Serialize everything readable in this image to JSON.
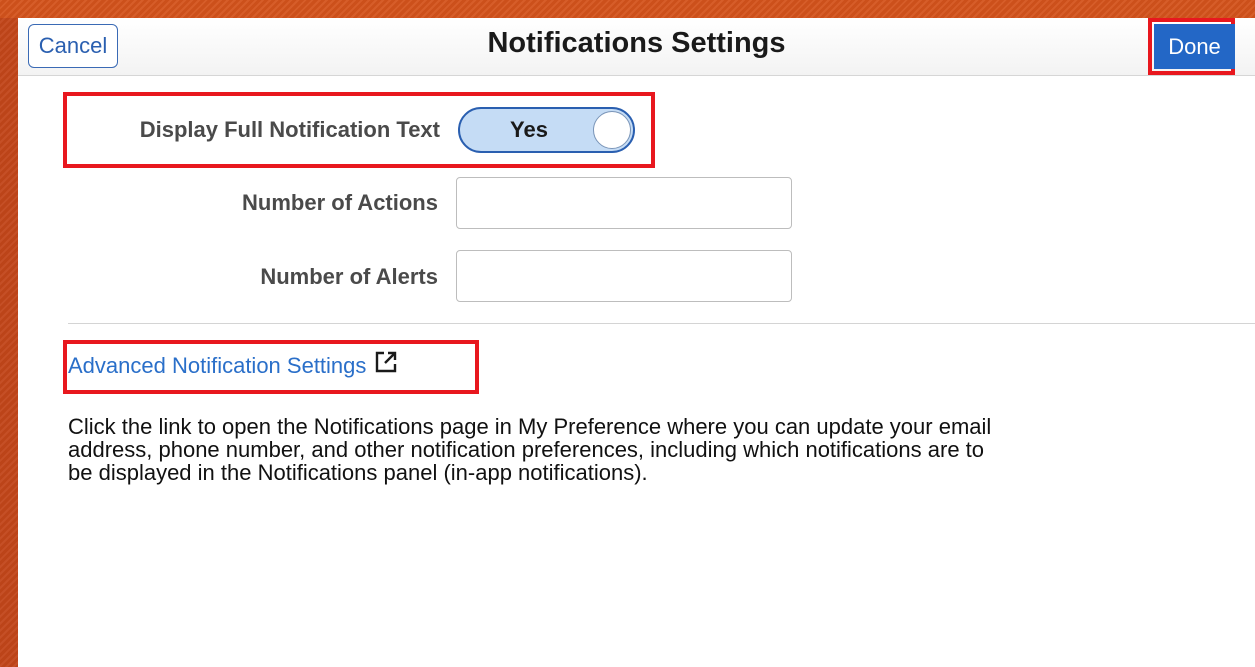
{
  "header": {
    "title": "Notifications Settings",
    "cancel_label": "Cancel",
    "done_label": "Done"
  },
  "form": {
    "display_full_text": {
      "label": "Display Full Notification Text",
      "value": "Yes"
    },
    "number_of_actions": {
      "label": "Number of Actions",
      "value": ""
    },
    "number_of_alerts": {
      "label": "Number of Alerts",
      "value": ""
    }
  },
  "advanced_link": {
    "label": "Advanced Notification Settings",
    "icon": "external-link-icon"
  },
  "description": "Click the link to open the Notifications page in My Preference where you can update your email address, phone number, and other notification preferences, including which notifications are to be displayed in the Notifications panel (in-app notifications).",
  "colors": {
    "accent": "#2367c6",
    "highlight": "#e8171e",
    "link": "#2a6fc9",
    "toggle_on": "#c5dcf5"
  }
}
